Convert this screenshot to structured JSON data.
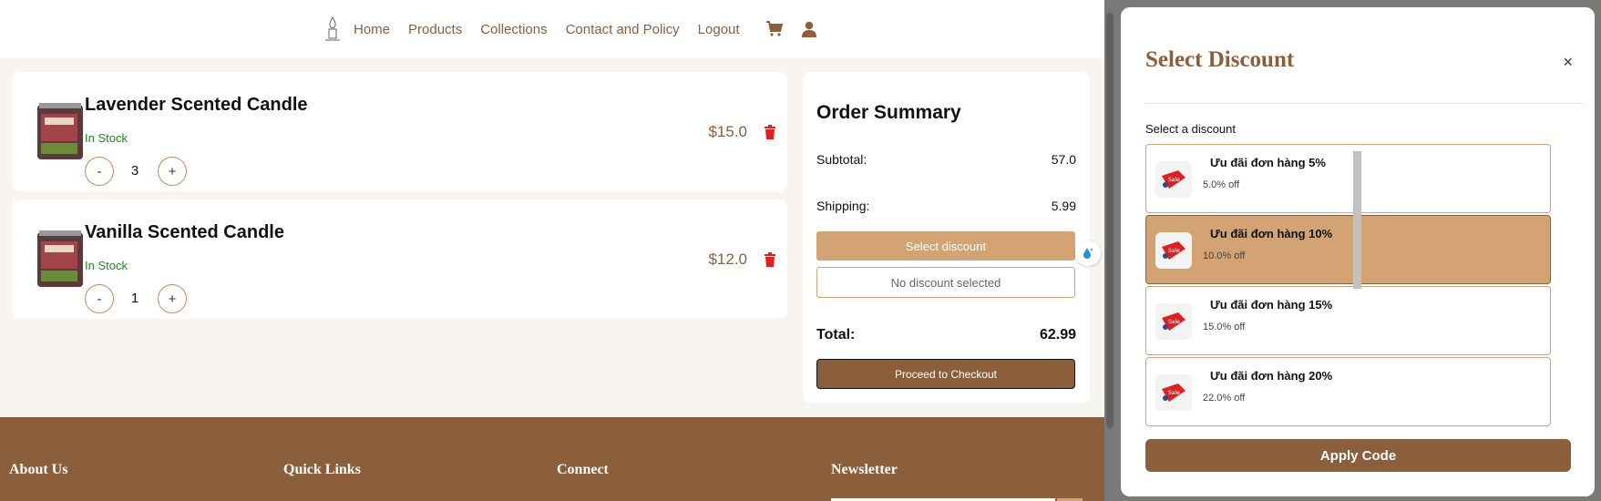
{
  "nav": {
    "items": [
      "Home",
      "Products",
      "Collections",
      "Contact and Policy",
      "Logout"
    ],
    "icons": [
      "candle-logo-icon",
      "cart-icon",
      "user-icon"
    ]
  },
  "cart": {
    "items": [
      {
        "name": "Lavender Scented Candle",
        "stock": "In Stock",
        "qty": "3",
        "price": "$15.0"
      },
      {
        "name": "Vanilla Scented Candle",
        "stock": "In Stock",
        "qty": "1",
        "price": "$12.0"
      }
    ],
    "minus": "-",
    "plus": "+"
  },
  "summary": {
    "title": "Order Summary",
    "subtotal_label": "Subtotal:",
    "subtotal_value": "57.0",
    "shipping_label": "Shipping:",
    "shipping_value": "5.99",
    "select_discount": "Select discount",
    "no_discount": "No discount selected",
    "total_label": "Total:",
    "total_value": "62.99",
    "checkout": "Proceed to Checkout"
  },
  "footer": {
    "about": "About Us",
    "links": "Quick Links",
    "connect": "Connect",
    "newsletter": "Newsletter"
  },
  "modal": {
    "title": "Select Discount",
    "close": "×",
    "label": "Select a discount",
    "options": [
      {
        "title": "Ưu đãi đơn hàng 5%",
        "sub": "5.0% off",
        "selected": false
      },
      {
        "title": "Ưu đãi đơn hàng 10%",
        "sub": "10.0% off",
        "selected": true
      },
      {
        "title": "Ưu đãi đơn hàng 15%",
        "sub": "15.0% off",
        "selected": false
      },
      {
        "title": "Ưu đãi đơn hàng 20%",
        "sub": "22.0% off",
        "selected": false
      }
    ],
    "apply": "Apply Code"
  },
  "colors": {
    "brand": "#8b5e3c",
    "accent": "#d4a373",
    "stock": "#1a8a1a",
    "trash": "#e02020"
  }
}
